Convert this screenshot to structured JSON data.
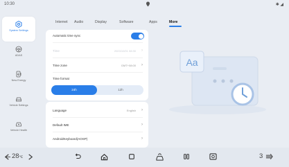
{
  "status_bar": {
    "time": "10:30",
    "right_indicators": "✱ ◢"
  },
  "sidebar": {
    "items": [
      {
        "label": "System Settings",
        "icon": "system-settings-icon",
        "active": true
      },
      {
        "label": "ADAS",
        "icon": "adas-icon",
        "active": false
      },
      {
        "label": "New Energy",
        "icon": "new-energy-icon",
        "active": false
      },
      {
        "label": "Vehicle Settings",
        "icon": "vehicle-settings-icon",
        "active": false
      },
      {
        "label": "Vehicle Health",
        "icon": "vehicle-health-icon",
        "active": false
      }
    ]
  },
  "tabs": [
    {
      "label": "Internet"
    },
    {
      "label": "Audio"
    },
    {
      "label": "Display"
    },
    {
      "label": "Software"
    },
    {
      "label": "Apps"
    },
    {
      "label": "More",
      "active": true
    }
  ],
  "settings": {
    "automatic_time_sync": {
      "label": "Automatic time sync",
      "enabled": true
    },
    "time": {
      "label": "Time",
      "value": "2023/10/01 08:30"
    },
    "time_zone": {
      "label": "Time zone",
      "value": "GMT+08:00"
    },
    "time_format": {
      "label": "Time format",
      "options": [
        "24h",
        "12h"
      ],
      "selected": "24h"
    },
    "language": {
      "label": "Language",
      "value": "English"
    },
    "default_ime": {
      "label": "Default IME"
    },
    "android_keyboard": {
      "label": "AndroidKeyboard(AOSP)"
    }
  },
  "illustration": {
    "text": "Aa"
  },
  "bottom_bar": {
    "temp_left": "28",
    "temp_left_unit": "℃",
    "fan_level": "3"
  },
  "colors": {
    "accent": "#2a7ee8",
    "background": "#e9edf3"
  }
}
